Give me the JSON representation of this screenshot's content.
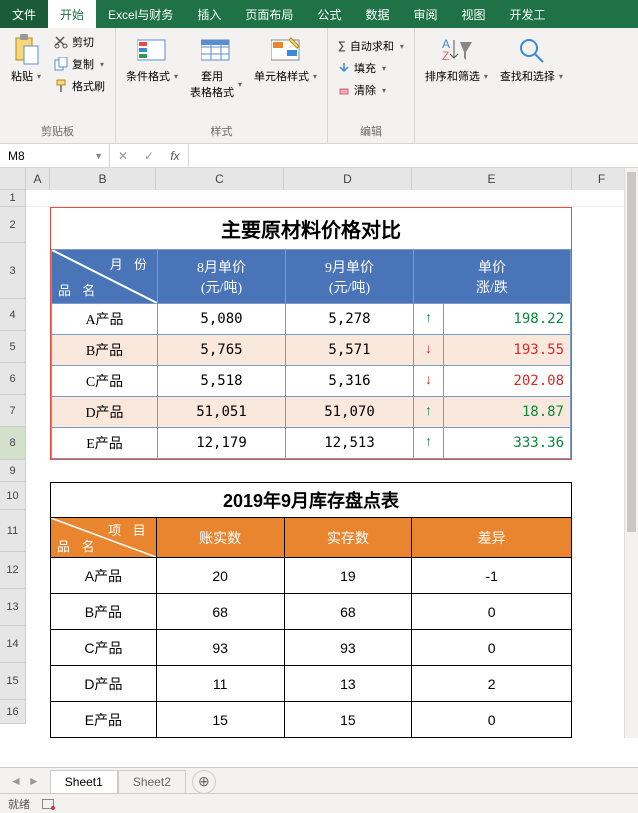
{
  "tabs": {
    "file": "文件",
    "home": "开始",
    "fin": "Excel与财务",
    "insert": "插入",
    "layout": "页面布局",
    "formula": "公式",
    "data": "数据",
    "review": "审阅",
    "view": "视图",
    "dev": "开发工"
  },
  "ribbon": {
    "clipboard": {
      "paste": "粘贴",
      "cut": "剪切",
      "copy": "复制",
      "painter": "格式刷",
      "group": "剪贴板"
    },
    "styles": {
      "cond": "条件格式",
      "tbl": "套用\n表格格式",
      "cell": "单元格样式",
      "group": "样式"
    },
    "editing": {
      "sum": "自动求和",
      "fill": "填充",
      "clear": "清除",
      "group": "编辑",
      "sort": "排序和筛选",
      "find": "查找和选择"
    }
  },
  "namebox": "M8",
  "cols": [
    "A",
    "B",
    "C",
    "D",
    "E",
    "F"
  ],
  "rows": [
    "1",
    "2",
    "3",
    "4",
    "5",
    "6",
    "7",
    "8",
    "9",
    "10",
    "11",
    "12",
    "13",
    "14",
    "15",
    "16"
  ],
  "table1": {
    "title": "主要原材料价格对比",
    "diag_top": "月 份",
    "diag_bot": "品 名",
    "h_aug": "8月单价\n(元/吨)",
    "h_sep": "9月单价\n(元/吨)",
    "h_chg": "单价\n涨/跌",
    "rows": [
      {
        "name": "A产品",
        "aug": "5,080",
        "sep": "5,278",
        "dir": "up",
        "chg": "198.22"
      },
      {
        "name": "B产品",
        "aug": "5,765",
        "sep": "5,571",
        "dir": "dn",
        "chg": "193.55"
      },
      {
        "name": "C产品",
        "aug": "5,518",
        "sep": "5,316",
        "dir": "dn",
        "chg": "202.08"
      },
      {
        "name": "D产品",
        "aug": "51,051",
        "sep": "51,070",
        "dir": "up",
        "chg": "18.87"
      },
      {
        "name": "E产品",
        "aug": "12,179",
        "sep": "12,513",
        "dir": "up",
        "chg": "333.36"
      }
    ]
  },
  "table2": {
    "title": "2019年9月库存盘点表",
    "diag_top": "项 目",
    "diag_bot": "品 名",
    "h_book": "账实数",
    "h_act": "实存数",
    "h_diff": "差异",
    "rows": [
      {
        "name": "A产品",
        "book": "20",
        "act": "19",
        "diff": "-1"
      },
      {
        "name": "B产品",
        "book": "68",
        "act": "68",
        "diff": "0"
      },
      {
        "name": "C产品",
        "book": "93",
        "act": "93",
        "diff": "0"
      },
      {
        "name": "D产品",
        "book": "11",
        "act": "13",
        "diff": "2"
      },
      {
        "name": "E产品",
        "book": "15",
        "act": "15",
        "diff": "0"
      }
    ]
  },
  "sheets": {
    "s1": "Sheet1",
    "s2": "Sheet2"
  },
  "status": {
    "ready": "就绪"
  }
}
